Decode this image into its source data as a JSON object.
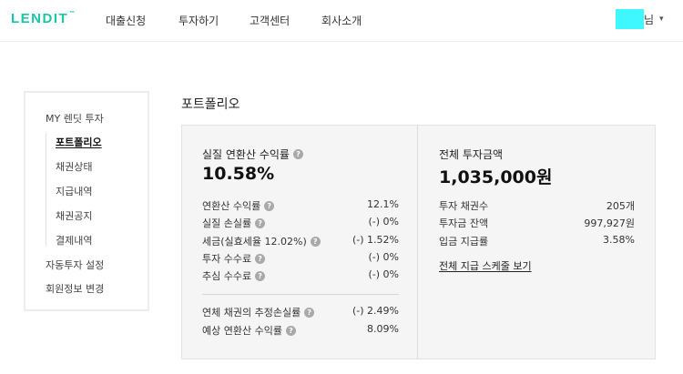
{
  "header": {
    "logo": "LENDIT",
    "logo_mark": "™",
    "nav": [
      "대출신청",
      "투자하기",
      "고객센터",
      "회사소개"
    ],
    "user_suffix": "님",
    "user_chevron": "▾"
  },
  "sidebar": {
    "section_title": "MY 렌딧 투자",
    "sub_items": [
      "포트폴리오",
      "채권상태",
      "지급내역",
      "채권공지",
      "결제내역"
    ],
    "active_item": "포트폴리오",
    "items": [
      "자동투자 설정",
      "회원정보 변경"
    ]
  },
  "page": {
    "title": "포트폴리오"
  },
  "returns": {
    "title": "실질 연환산 수익률",
    "value": "10.58%",
    "rows": [
      {
        "label": "연환산 수익률",
        "value": "12.1%"
      },
      {
        "label": "실질 손실률",
        "value": "(-) 0%"
      },
      {
        "label": "세금(실효세율 12.02%)",
        "value": "(-) 1.52%"
      },
      {
        "label": "투자 수수료",
        "value": "(-) 0%"
      },
      {
        "label": "추심 수수료",
        "value": "(-) 0%"
      }
    ],
    "rows2": [
      {
        "label": "연체 채권의 추정손실률",
        "value": "(-) 2.49%"
      },
      {
        "label": "예상 연환산 수익률",
        "value": "8.09%"
      }
    ]
  },
  "investment": {
    "title": "전체 투자금액",
    "value": "1,035,000원",
    "rows": [
      {
        "label": "투자 채권수",
        "value": "205개"
      },
      {
        "label": "투자금 잔액",
        "value": "997,927원"
      },
      {
        "label": "입금 지급률",
        "value": "3.58%"
      }
    ],
    "link": "전체 지급 스케줄 보기"
  },
  "colors": {
    "brand": "#18c7a6",
    "panel_bg": "#f5f5f5",
    "user_mask": "#3ff7ff"
  },
  "icons": {
    "help": "question-circle-icon"
  }
}
